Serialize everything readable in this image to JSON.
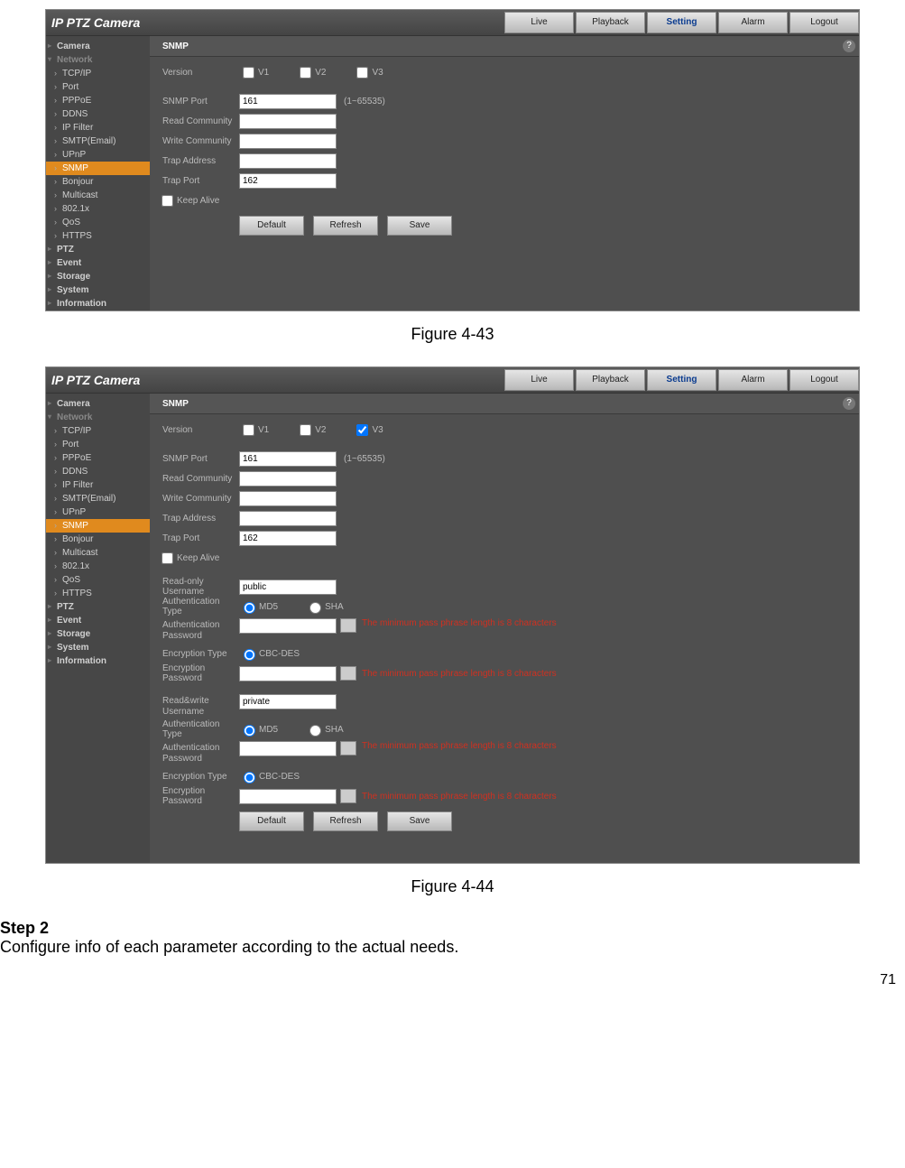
{
  "page_number": "71",
  "figures": {
    "fig1_caption": "Figure 4-43",
    "fig2_caption": "Figure 4-44"
  },
  "step": {
    "title": "Step 2",
    "desc": "Configure info of each parameter according to the actual needs."
  },
  "header": {
    "title": "IP PTZ Camera",
    "tabs": {
      "live": "Live",
      "playback": "Playback",
      "setting": "Setting",
      "alarm": "Alarm",
      "logout": "Logout"
    }
  },
  "sidebar": {
    "camera": "Camera",
    "network": "Network",
    "tcpip": "TCP/IP",
    "port": "Port",
    "pppoe": "PPPoE",
    "ddns": "DDNS",
    "ipfilter": "IP Filter",
    "smtp": "SMTP(Email)",
    "upnp": "UPnP",
    "snmp": "SNMP",
    "bonjour": "Bonjour",
    "multicast": "Multicast",
    "dot1x": "802.1x",
    "qos": "QoS",
    "https": "HTTPS",
    "ptz": "PTZ",
    "event": "Event",
    "storage": "Storage",
    "system": "System",
    "information": "Information"
  },
  "snmp": {
    "section_title": "SNMP",
    "version_label": "Version",
    "v1": "V1",
    "v2": "V2",
    "v3": "V3",
    "snmp_port_label": "SNMP Port",
    "snmp_port_value": "161",
    "snmp_port_hint": "(1~65535)",
    "read_comm_label": "Read Community",
    "write_comm_label": "Write Community",
    "trap_addr_label": "Trap Address",
    "trap_port_label": "Trap Port",
    "trap_port_value": "162",
    "keep_alive_label": "Keep Alive",
    "ro_user_label": "Read-only Username",
    "ro_user_value": "public",
    "auth_type_label": "Authentication Type",
    "md5": "MD5",
    "sha": "SHA",
    "auth_pw_label": "Authentication Password",
    "enc_type_label": "Encryption Type",
    "cbc_des": "CBC-DES",
    "enc_pw_label": "Encryption Password",
    "rw_user_label": "Read&write Username",
    "rw_user_value": "private",
    "warn": "The minimum pass phrase length is 8 characters",
    "btn_default": "Default",
    "btn_refresh": "Refresh",
    "btn_save": "Save"
  }
}
